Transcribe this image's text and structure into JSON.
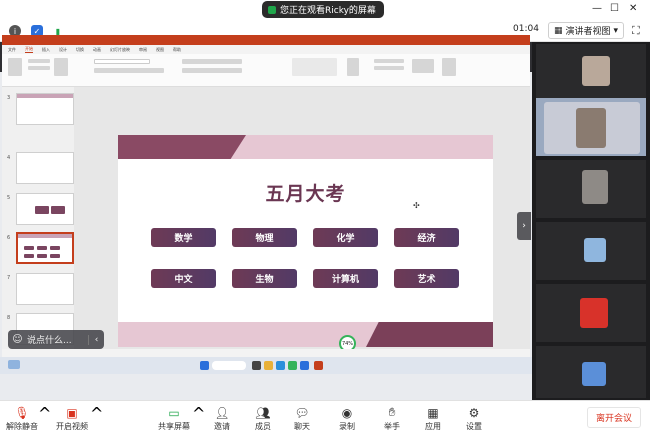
{
  "top": {
    "viewing_text": "您正在观看Ricky的屏幕",
    "timer": "01:04",
    "presenter_view": "演讲者视图"
  },
  "slide": {
    "title": "五月大考",
    "subjects_row1": [
      "数学",
      "物理",
      "化学",
      "经济"
    ],
    "subjects_row2": [
      "中文",
      "生物",
      "计算机",
      "艺术"
    ],
    "progress_badge": "74%"
  },
  "ppt": {
    "tabs": [
      "文件",
      "开始",
      "插入",
      "设计",
      "切换",
      "动画",
      "幻灯片放映",
      "审阅",
      "视图",
      "帮助"
    ]
  },
  "chat": {
    "placeholder": "说点什么..."
  },
  "controls": {
    "unmute": "解除静音",
    "start_video": "开启视频",
    "share_screen": "共享屏幕",
    "invite": "邀请",
    "members": "成员",
    "chat": "聊天",
    "record": "录制",
    "raise_hand": "举手",
    "apps": "应用",
    "settings": "设置",
    "leave": "离开会议"
  },
  "colors": {
    "slide_accent": "#6e3a55",
    "ppt_brand": "#c43e1c",
    "leave_red": "#d9331f"
  }
}
